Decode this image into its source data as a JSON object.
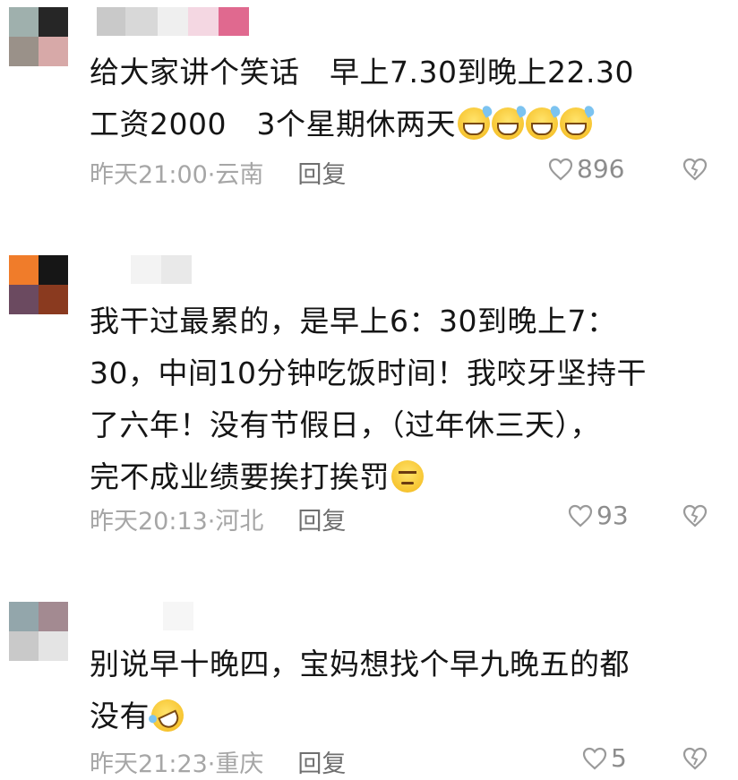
{
  "comments": [
    {
      "text_lines": [
        "给大家讲个笑话　早上7.30到晚上22.30",
        "工资2000　3个星期休两天"
      ],
      "emoji_tail": [
        "sweat-smile",
        "sweat-smile",
        "sweat-smile",
        "sweat-smile"
      ],
      "time_location": "昨天21:00·云南",
      "reply_label": "回复",
      "like_count": "896"
    },
    {
      "text_lines": [
        "我干过最累的，是早上6：30到晚上7：",
        "30，中间10分钟吃饭时间！我咬牙坚持干",
        "了六年！没有节假日，（过年休三天），",
        "完不成业绩要挨打挨罚"
      ],
      "emoji_tail": [
        "smirk"
      ],
      "time_location": "昨天20:13·河北",
      "reply_label": "回复",
      "like_count": "93"
    },
    {
      "text_lines": [
        "别说早十晚四，宝妈想找个早九晚五的都",
        "没有"
      ],
      "emoji_tail": [
        "rolling-on-floor-laughing"
      ],
      "time_location": "昨天21:23·重庆",
      "reply_label": "回复",
      "like_count": "5"
    }
  ],
  "colors": {
    "text": "#151515",
    "meta": "#a6a6a6",
    "reply": "#6f6f6f",
    "icon": "#9a9a9a"
  },
  "icons": {
    "like": "heart-outline-icon",
    "dislike": "broken-heart-outline-icon"
  }
}
